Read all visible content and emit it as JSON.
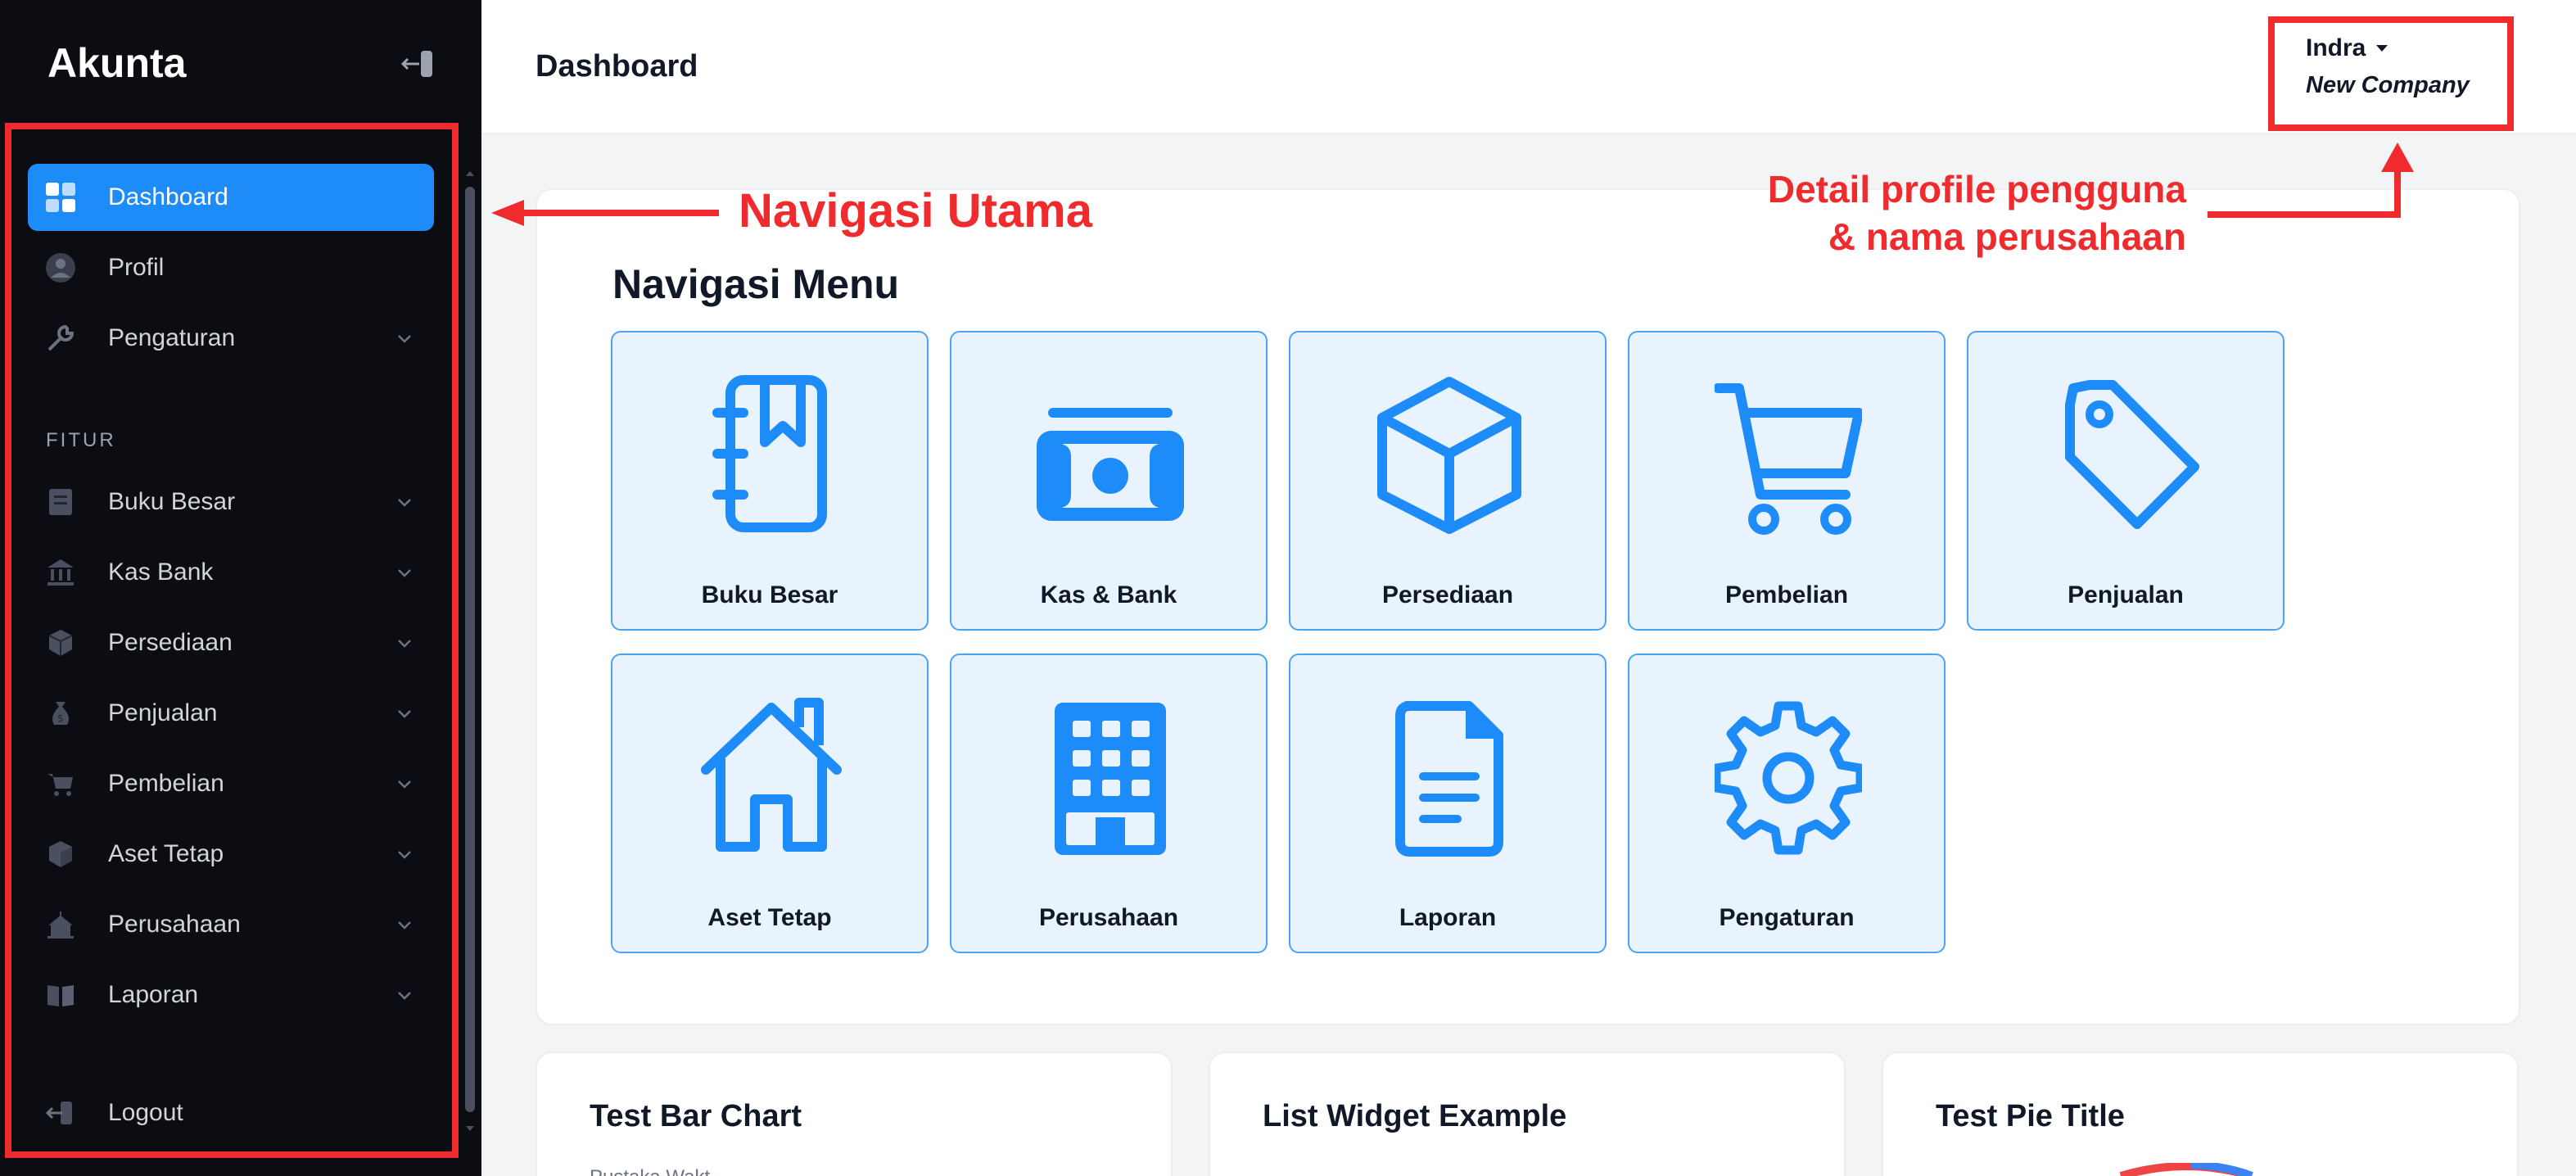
{
  "app": {
    "brand": "Akunta"
  },
  "header": {
    "page_title": "Dashboard"
  },
  "profile": {
    "user_name": "Indra",
    "company": "New Company"
  },
  "sidebar": {
    "items": [
      {
        "label": "Dashboard",
        "icon": "dashboard-icon",
        "active": true
      },
      {
        "label": "Profil",
        "icon": "user-icon"
      },
      {
        "label": "Pengaturan",
        "icon": "wrench-icon",
        "has_submenu": true
      }
    ],
    "section_label": "FITUR",
    "feature_items": [
      {
        "label": "Buku Besar",
        "icon": "ledger-icon"
      },
      {
        "label": "Kas Bank",
        "icon": "bank-icon"
      },
      {
        "label": "Persediaan",
        "icon": "box-icon"
      },
      {
        "label": "Penjualan",
        "icon": "money-bag-icon"
      },
      {
        "label": "Pembelian",
        "icon": "cart-icon"
      },
      {
        "label": "Aset Tetap",
        "icon": "cube-icon"
      },
      {
        "label": "Perusahaan",
        "icon": "building-icon"
      },
      {
        "label": "Laporan",
        "icon": "book-icon"
      }
    ],
    "logout_label": "Logout"
  },
  "menu_card": {
    "title": "Navigasi Menu",
    "tiles": [
      {
        "label": "Buku Besar",
        "icon": "ledger-book-icon"
      },
      {
        "label": "Kas & Bank",
        "icon": "cash-icon"
      },
      {
        "label": "Persediaan",
        "icon": "box-icon"
      },
      {
        "label": "Pembelian",
        "icon": "cart-icon"
      },
      {
        "label": "Penjualan",
        "icon": "tag-icon"
      },
      {
        "label": "Aset Tetap",
        "icon": "house-icon"
      },
      {
        "label": "Perusahaan",
        "icon": "building-icon"
      },
      {
        "label": "Laporan",
        "icon": "document-icon"
      },
      {
        "label": "Pengaturan",
        "icon": "gear-icon"
      }
    ]
  },
  "widgets": [
    {
      "title": "Test Bar Chart",
      "subtext": "Pustaka Wakt"
    },
    {
      "title": "List Widget Example"
    },
    {
      "title": "Test Pie Title"
    }
  ],
  "annotations": {
    "nav_main": "Navigasi Utama",
    "profile_line1": "Detail profile pengguna",
    "profile_line2": "& nama perusahaan"
  },
  "colors": {
    "accent": "#1d8cf8",
    "sidebar_bg": "#0b0d12",
    "annotation": "#ef2b2d",
    "tile_bg": "#e8f3fd"
  }
}
